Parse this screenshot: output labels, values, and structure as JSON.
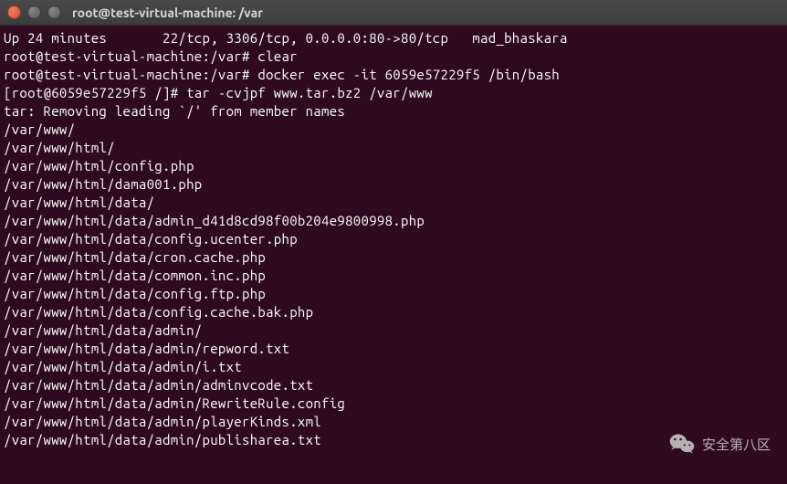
{
  "window": {
    "title": "root@test-virtual-machine: /var"
  },
  "terminal": {
    "lines": [
      "Up 24 minutes       22/tcp, 3306/tcp, 0.0.0.0:80->80/tcp   mad_bhaskara",
      "root@test-virtual-machine:/var# clear",
      "",
      "root@test-virtual-machine:/var# docker exec -it 6059e57229f5 /bin/bash",
      "[root@6059e57229f5 /]# tar -cvjpf www.tar.bz2 /var/www",
      "tar: Removing leading `/' from member names",
      "/var/www/",
      "/var/www/html/",
      "/var/www/html/config.php",
      "/var/www/html/dama001.php",
      "/var/www/html/data/",
      "/var/www/html/data/admin_d41d8cd98f00b204e9800998.php",
      "/var/www/html/data/config.ucenter.php",
      "/var/www/html/data/cron.cache.php",
      "/var/www/html/data/common.inc.php",
      "/var/www/html/data/config.ftp.php",
      "/var/www/html/data/config.cache.bak.php",
      "/var/www/html/data/admin/",
      "/var/www/html/data/admin/repword.txt",
      "/var/www/html/data/admin/i.txt",
      "/var/www/html/data/admin/adminvcode.txt",
      "/var/www/html/data/admin/RewriteRule.config",
      "/var/www/html/data/admin/playerKinds.xml",
      "/var/www/html/data/admin/publisharea.txt"
    ]
  },
  "watermark": {
    "text": "安全第八区"
  }
}
